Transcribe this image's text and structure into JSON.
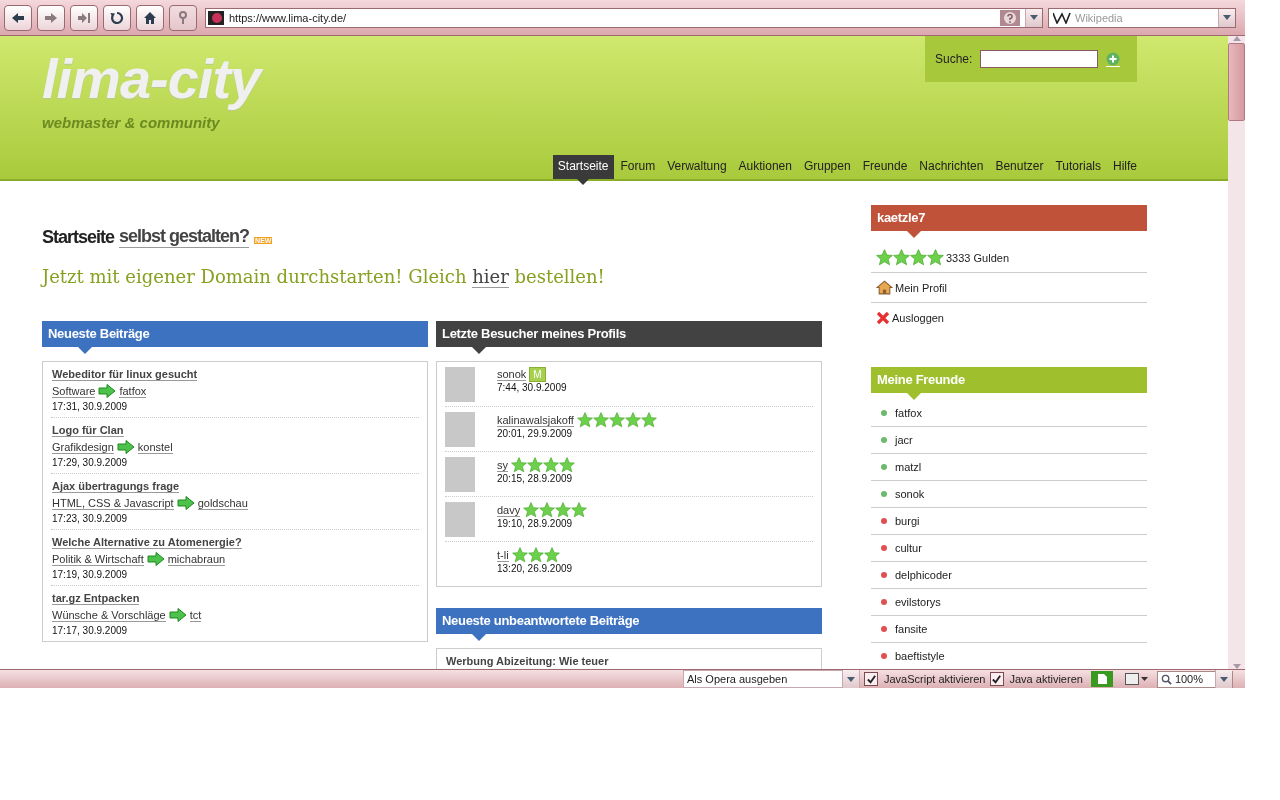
{
  "browser": {
    "address": "https://www.lima-city.de/",
    "search_placeholder": "Wikipedia"
  },
  "header": {
    "logo": "lima-city",
    "tagline": "webmaster & community",
    "search_label": "Suche:"
  },
  "nav": [
    {
      "label": "Startseite",
      "selected": true
    },
    {
      "label": "Forum",
      "selected": false
    },
    {
      "label": "Verwaltung",
      "selected": false
    },
    {
      "label": "Auktionen",
      "selected": false
    },
    {
      "label": "Gruppen",
      "selected": false
    },
    {
      "label": "Freunde",
      "selected": false
    },
    {
      "label": "Nachrichten",
      "selected": false
    },
    {
      "label": "Benutzer",
      "selected": false
    },
    {
      "label": "Tutorials",
      "selected": false
    },
    {
      "label": "Hilfe",
      "selected": false
    }
  ],
  "intro": {
    "title": "Startseite",
    "title_link": "selbst gestalten?",
    "badge": "NEW",
    "promo_before": "Jetzt mit eigener Domain durchstarten! Gleich",
    "promo_link": "hier",
    "promo_after": "bestellen!"
  },
  "latest_posts": {
    "title": "Neueste Beiträge",
    "items": [
      {
        "title": "Webeditor für linux gesucht",
        "category": "Software",
        "author": "fatfox",
        "time": "17:31, 30.9.2009"
      },
      {
        "title": "Logo für Clan",
        "category": "Grafikdesign",
        "author": "konstel",
        "time": "17:29, 30.9.2009"
      },
      {
        "title": "Ajax übertragungs frage",
        "category": "HTML, CSS & Javascript",
        "author": "goldschau",
        "time": "17:23, 30.9.2009"
      },
      {
        "title": "Welche Alternative zu Atomenergie?",
        "category": "Politik & Wirtschaft",
        "author": "michabraun",
        "time": "17:19, 30.9.2009"
      },
      {
        "title": "tar.gz Entpacken",
        "category": "Wünsche & Vorschläge",
        "author": "tct",
        "time": "17:17, 30.9.2009"
      }
    ]
  },
  "visitors": {
    "title": "Letzte Besucher meines Profils",
    "items": [
      {
        "name": "sonok",
        "badge": "M",
        "avatar": true,
        "time": "7:44, 30.9.2009"
      },
      {
        "name": "kalinawalsjakoff",
        "stars": 5,
        "avatar": true,
        "time": "20:01, 29.9.2009"
      },
      {
        "name": "sy",
        "stars": 4,
        "avatar": true,
        "time": "20:15, 28.9.2009"
      },
      {
        "name": "davy",
        "stars": 4,
        "avatar": true,
        "time": "19:10, 28.9.2009"
      },
      {
        "name": "t-li",
        "stars": 3,
        "avatar": false,
        "time": "13:20, 26.9.2009"
      }
    ]
  },
  "unanswered": {
    "title": "Neueste unbeantwortete Beiträge",
    "items": [
      {
        "title": "Werbung Abizeitung: Wie teuer"
      }
    ]
  },
  "user": {
    "name": "kaetzle7",
    "stars": 4,
    "money": "3333 Gulden",
    "links": [
      {
        "kind": "profile",
        "label": "Mein Profil"
      },
      {
        "kind": "logout",
        "label": "Ausloggen"
      }
    ]
  },
  "friends": {
    "title": "Meine Freunde",
    "items": [
      {
        "name": "fatfox",
        "color": "#6cb86c"
      },
      {
        "name": "jacr",
        "color": "#6cb86c"
      },
      {
        "name": "matzl",
        "color": "#6cb86c"
      },
      {
        "name": "sonok",
        "color": "#6cb86c"
      },
      {
        "name": "burgi",
        "color": "#e05050"
      },
      {
        "name": "cultur",
        "color": "#e05050"
      },
      {
        "name": "delphicoder",
        "color": "#e05050"
      },
      {
        "name": "evilstorys",
        "color": "#e05050"
      },
      {
        "name": "fansite",
        "color": "#e05050"
      },
      {
        "name": "baeftistyle",
        "color": "#e05050"
      }
    ]
  },
  "status_bar": {
    "identify_as": "Als Opera ausgeben",
    "toggles": [
      {
        "label": "JavaScript aktivieren",
        "checked": true
      },
      {
        "label": "Java aktivieren",
        "checked": true
      }
    ],
    "zoom": "100%"
  }
}
